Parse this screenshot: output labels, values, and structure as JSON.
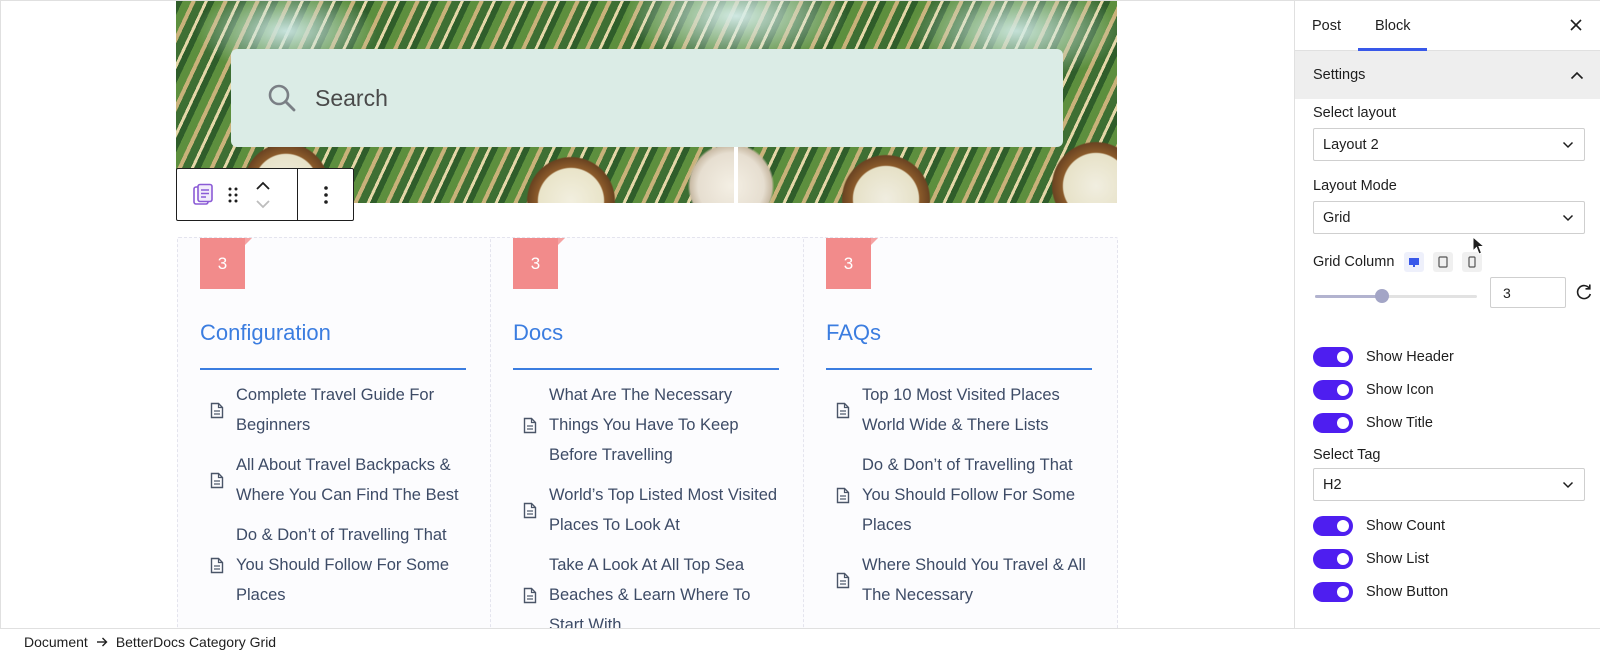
{
  "canvas": {
    "search": {
      "label": "Search"
    },
    "toolbar": {
      "icons": [
        "betterdocs-block-icon",
        "drag-handle-icon",
        "move-up-icon",
        "move-down-icon",
        "more-options-icon"
      ]
    },
    "cards": [
      {
        "count": "3",
        "title": "Configuration",
        "docs": [
          "Complete Travel Guide For Beginners",
          "All About Travel Backpacks & Where You Can Find The Best",
          "Do & Don’t of Travelling That You Should Follow For Some Places"
        ]
      },
      {
        "count": "3",
        "title": "Docs",
        "docs": [
          "What Are The Necessary Things You Have To Keep Before Travelling",
          "World’s Top Listed Most Visited Places To Look At",
          "Take A Look At All Top Sea Beaches & Learn Where To Start With"
        ]
      },
      {
        "count": "3",
        "title": "FAQs",
        "docs": [
          "Top 10 Most Visited Places World Wide & There Lists",
          "Do & Don’t of Travelling That You Should Follow For Some Places",
          "Where Should You Travel & All The Necessary"
        ]
      }
    ],
    "colors": {
      "accent": "#3b7de0",
      "badge": "#f28b8b",
      "search_bg": "#dbece6"
    }
  },
  "sidebar": {
    "tabs": [
      "Post",
      "Block"
    ],
    "active_tab": "Block",
    "panel_title": "Settings",
    "select_layout": {
      "label": "Select layout",
      "value": "Layout 2"
    },
    "layout_mode": {
      "label": "Layout Mode",
      "value": "Grid"
    },
    "grid_column": {
      "label": "Grid Column",
      "value": "3",
      "devices": [
        "desktop-icon",
        "tablet-icon",
        "mobile-icon"
      ]
    },
    "toggles_top": [
      {
        "label": "Show Header",
        "on": true
      },
      {
        "label": "Show Icon",
        "on": true
      },
      {
        "label": "Show Title",
        "on": true
      }
    ],
    "select_tag": {
      "label": "Select Tag",
      "value": "H2"
    },
    "toggles_bottom": [
      {
        "label": "Show Count",
        "on": true
      },
      {
        "label": "Show List",
        "on": true
      },
      {
        "label": "Show Button",
        "on": true
      }
    ],
    "colors": {
      "toggle_on": "#4e1ef0",
      "tab_indicator": "#3858e9"
    }
  },
  "footer": {
    "breadcrumb": [
      "Document",
      "BetterDocs Category Grid"
    ]
  }
}
